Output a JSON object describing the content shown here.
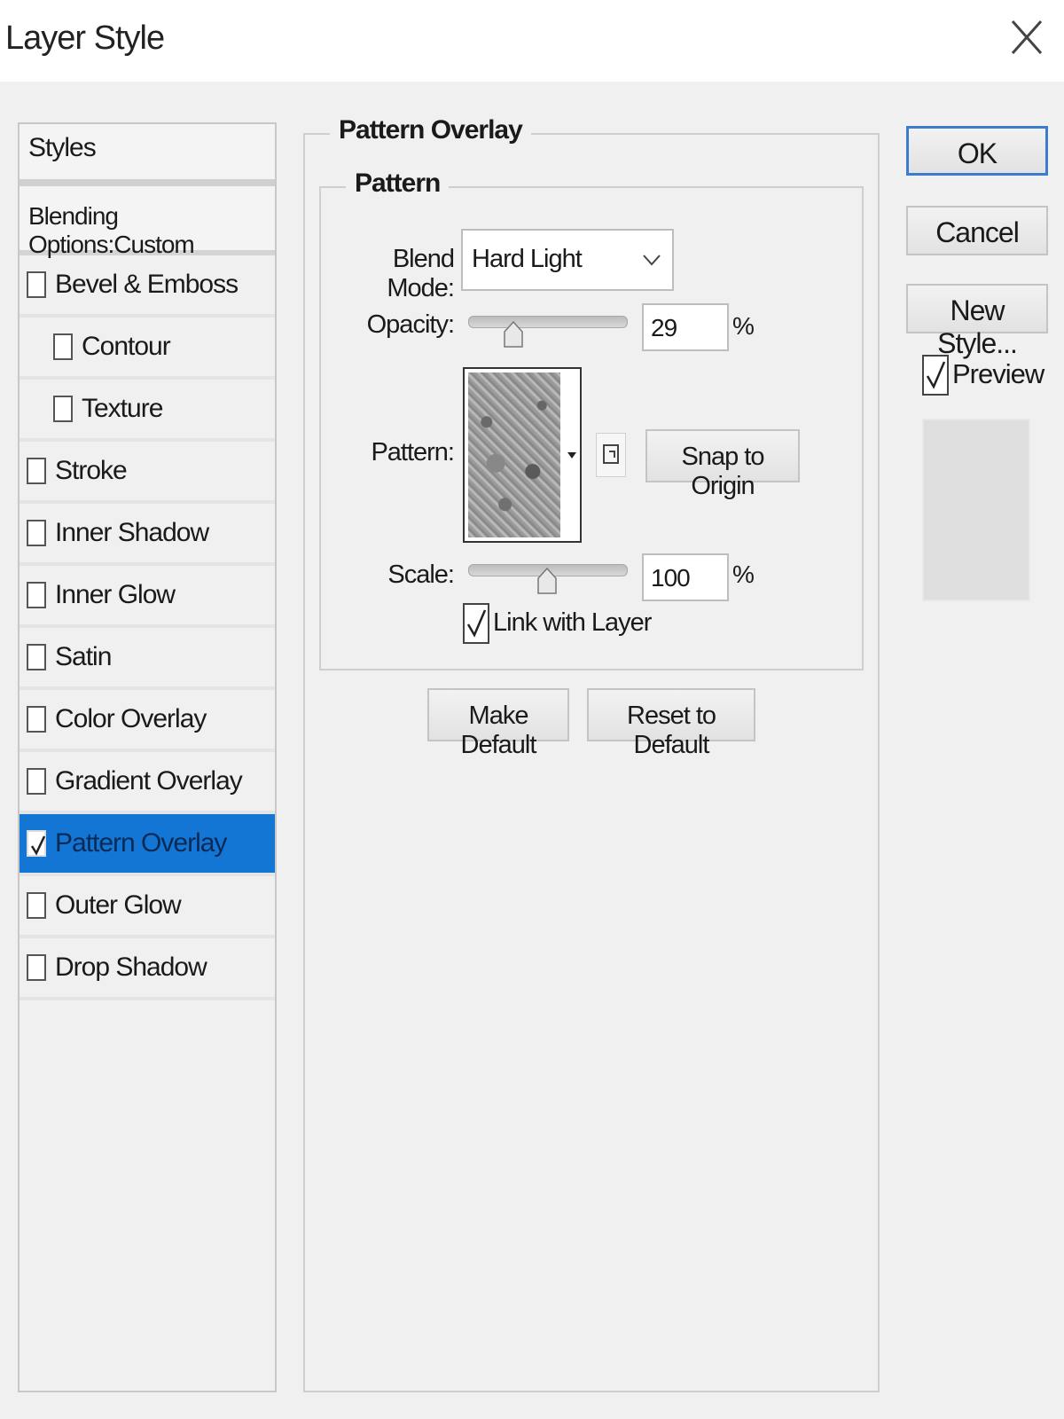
{
  "window": {
    "title": "Layer Style"
  },
  "styles_panel": {
    "header": "Styles",
    "blending": "Blending Options:Custom",
    "items": [
      {
        "label": "Bevel & Emboss",
        "checked": false,
        "indent": false
      },
      {
        "label": "Contour",
        "checked": false,
        "indent": true
      },
      {
        "label": "Texture",
        "checked": false,
        "indent": true
      },
      {
        "label": "Stroke",
        "checked": false,
        "indent": false
      },
      {
        "label": "Inner Shadow",
        "checked": false,
        "indent": false
      },
      {
        "label": "Inner Glow",
        "checked": false,
        "indent": false
      },
      {
        "label": "Satin",
        "checked": false,
        "indent": false
      },
      {
        "label": "Color Overlay",
        "checked": false,
        "indent": false
      },
      {
        "label": "Gradient Overlay",
        "checked": false,
        "indent": false
      },
      {
        "label": "Pattern Overlay",
        "checked": true,
        "indent": false,
        "selected": true
      },
      {
        "label": "Outer Glow",
        "checked": false,
        "indent": false
      },
      {
        "label": "Drop Shadow",
        "checked": false,
        "indent": false
      }
    ]
  },
  "pattern_overlay": {
    "group_title": "Pattern Overlay",
    "subgroup_title": "Pattern",
    "blend_mode_label": "Blend Mode:",
    "blend_mode_value": "Hard Light",
    "opacity_label": "Opacity:",
    "opacity_value": "29",
    "opacity_unit": "%",
    "pattern_label": "Pattern:",
    "snap_to_origin": "Snap to Origin",
    "scale_label": "Scale:",
    "scale_value": "100",
    "scale_unit": "%",
    "link_with_layer": "Link with Layer",
    "link_with_layer_checked": true,
    "make_default": "Make Default",
    "reset_to_default": "Reset to Default"
  },
  "actions": {
    "ok": "OK",
    "cancel": "Cancel",
    "new_style": "New Style...",
    "preview": "Preview",
    "preview_checked": true
  },
  "colors": {
    "selection": "#1476d4",
    "ok_border": "#3c7bd0"
  }
}
